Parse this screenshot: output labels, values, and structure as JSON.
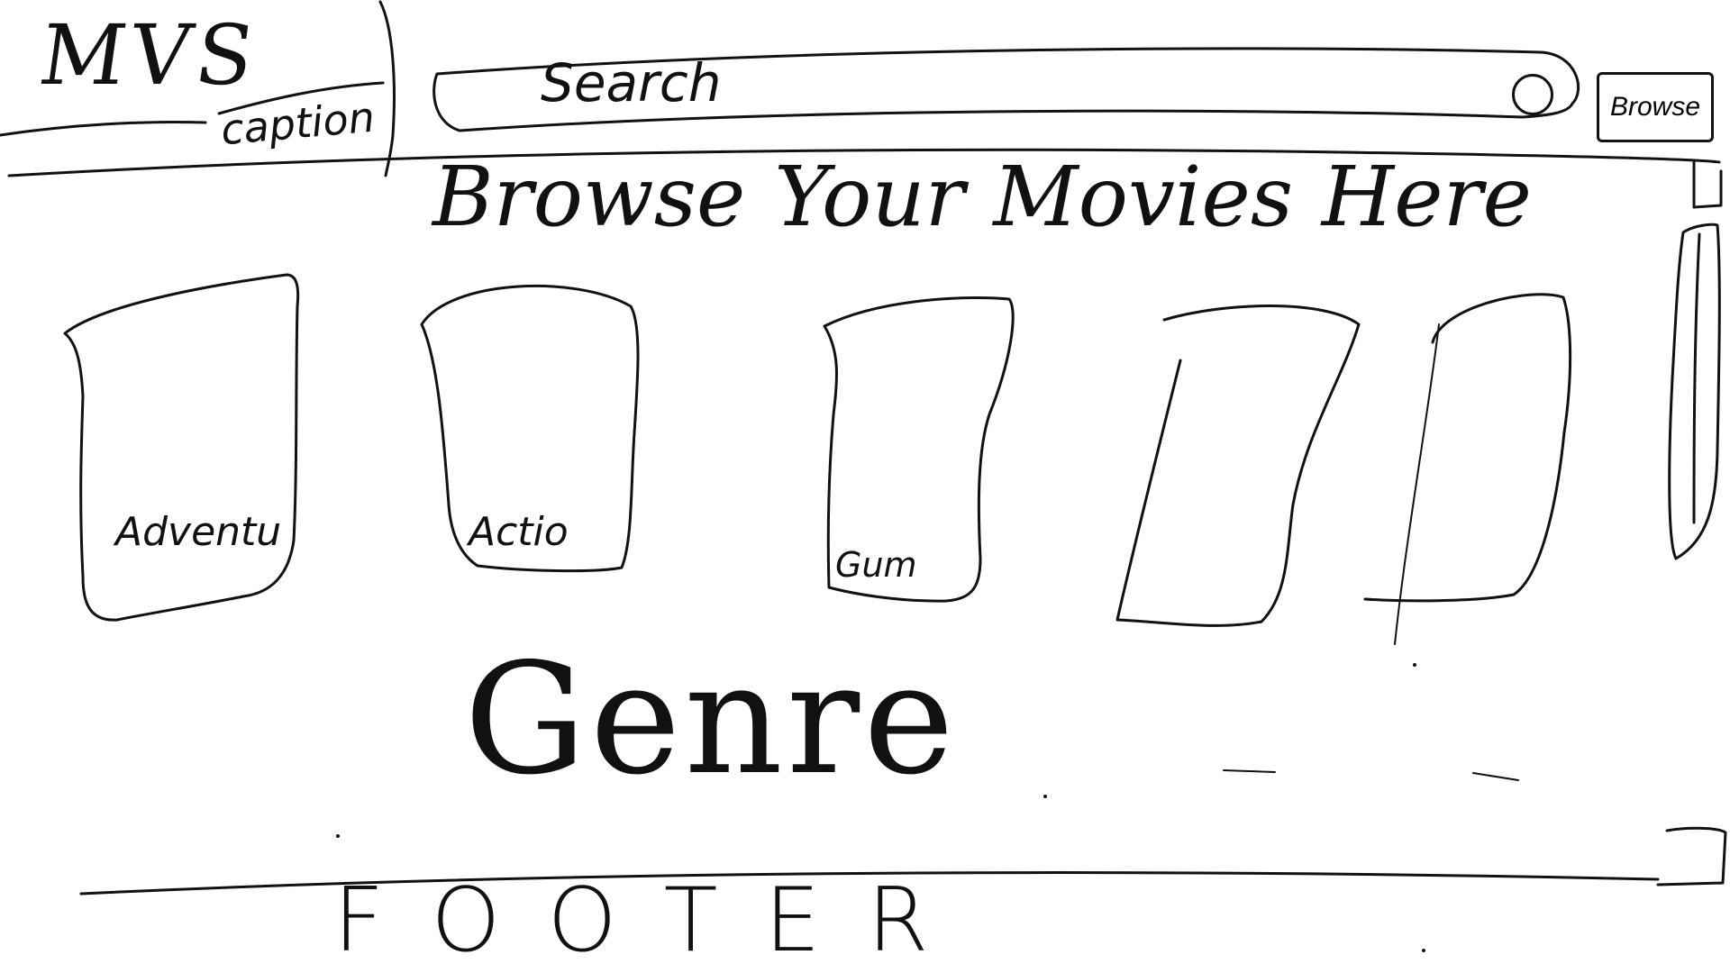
{
  "header": {
    "logo": "MVS",
    "caption": "caption",
    "search": {
      "placeholder": "Search"
    },
    "browse_button_label": "Browse"
  },
  "main": {
    "headline_words": [
      "Browse",
      "Your",
      "Movies",
      "Here"
    ],
    "genres": [
      {
        "label": "Adventu"
      },
      {
        "label": "Actio"
      },
      {
        "label": "Gum"
      },
      {
        "label": ""
      },
      {
        "label": ""
      }
    ],
    "section_title": "Genre"
  },
  "footer": {
    "label": "FOOTER"
  }
}
